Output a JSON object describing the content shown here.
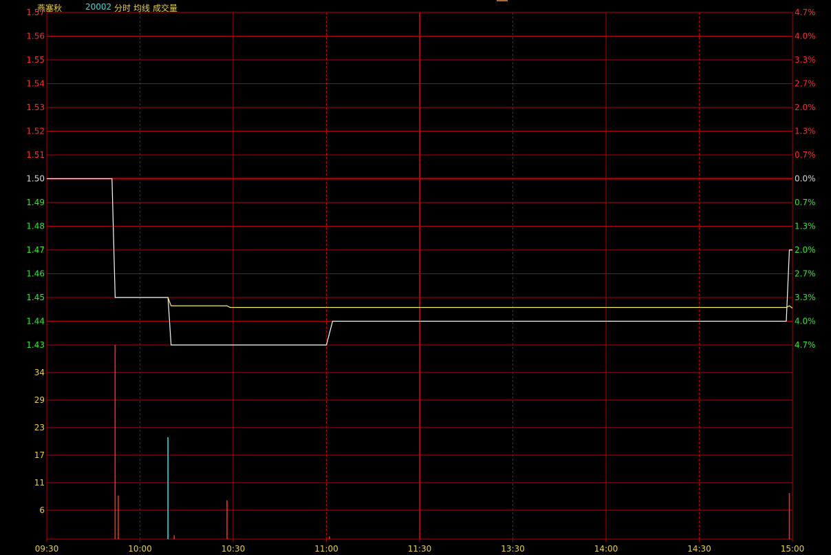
{
  "header": {
    "name": "燕塞秋",
    "code": "20002",
    "mode": "分时",
    "avg_label": "均线",
    "vol_label": "成交量"
  },
  "colors": {
    "background": "#000000",
    "grid": "#b40000",
    "up": "#ff2a2a",
    "down": "#2fe82f",
    "neutral": "#d8d8d8",
    "volume_label": "#e8d23a",
    "price_line": "#ffffff",
    "avg_line": "#f2f06a",
    "code_color": "#33e0e0",
    "name_color": "#e8d23a",
    "time_color": "#e8d23a"
  },
  "chart_data": {
    "type": "line",
    "prev_close": 1.5,
    "price_axis": {
      "ylim": [
        1.43,
        1.57
      ],
      "ticks": [
        1.57,
        1.56,
        1.55,
        1.54,
        1.53,
        1.52,
        1.51,
        1.5,
        1.49,
        1.48,
        1.47,
        1.46,
        1.45,
        1.44,
        1.43
      ],
      "tick_labels": [
        "1.57",
        "1.56",
        "1.55",
        "1.54",
        "1.53",
        "1.52",
        "1.51",
        "1.50",
        "1.49",
        "1.48",
        "1.47",
        "1.46",
        "1.45",
        "1.44",
        "1.43"
      ]
    },
    "pct_axis": {
      "tick_labels": [
        "4.7%",
        "4.0%",
        "3.3%",
        "2.7%",
        "2.0%",
        "1.3%",
        "0.7%",
        "0.0%",
        "0.7%",
        "1.3%",
        "2.0%",
        "2.7%",
        "3.3%",
        "4.0%",
        "4.7%"
      ]
    },
    "volume_axis": {
      "ylim": [
        0,
        40
      ],
      "tick_labels": [
        "34",
        "29",
        "23",
        "17",
        "11",
        "6"
      ]
    },
    "time_axis": {
      "ticks": [
        "09:30",
        "10:00",
        "10:30",
        "11:00",
        "11:30",
        "13:30",
        "14:00",
        "14:30",
        "15:00"
      ]
    },
    "series": [
      {
        "name": "分时",
        "points": [
          [
            0,
            1.5
          ],
          [
            21,
            1.5
          ],
          [
            22,
            1.45
          ],
          [
            39,
            1.45
          ],
          [
            40,
            1.43
          ],
          [
            90,
            1.43
          ],
          [
            92,
            1.44
          ],
          [
            238,
            1.44
          ],
          [
            239,
            1.47
          ],
          [
            240,
            1.47
          ]
        ]
      },
      {
        "name": "均线",
        "points": [
          [
            39,
            1.45
          ],
          [
            40,
            1.4465
          ],
          [
            58,
            1.4465
          ],
          [
            59,
            1.4458
          ],
          [
            238,
            1.4458
          ],
          [
            239,
            1.4465
          ],
          [
            240,
            1.4455
          ]
        ]
      }
    ],
    "volume": [
      {
        "t": 22,
        "v": 40,
        "color": "up"
      },
      {
        "t": 23,
        "v": 9,
        "color": "up"
      },
      {
        "t": 39,
        "v": 21,
        "color": "flat"
      },
      {
        "t": 41,
        "v": 0.8,
        "color": "up"
      },
      {
        "t": 58,
        "v": 8,
        "color": "up"
      },
      {
        "t": 91,
        "v": 0.6,
        "color": "up"
      },
      {
        "t": 239,
        "v": 9.5,
        "color": "up"
      }
    ]
  }
}
